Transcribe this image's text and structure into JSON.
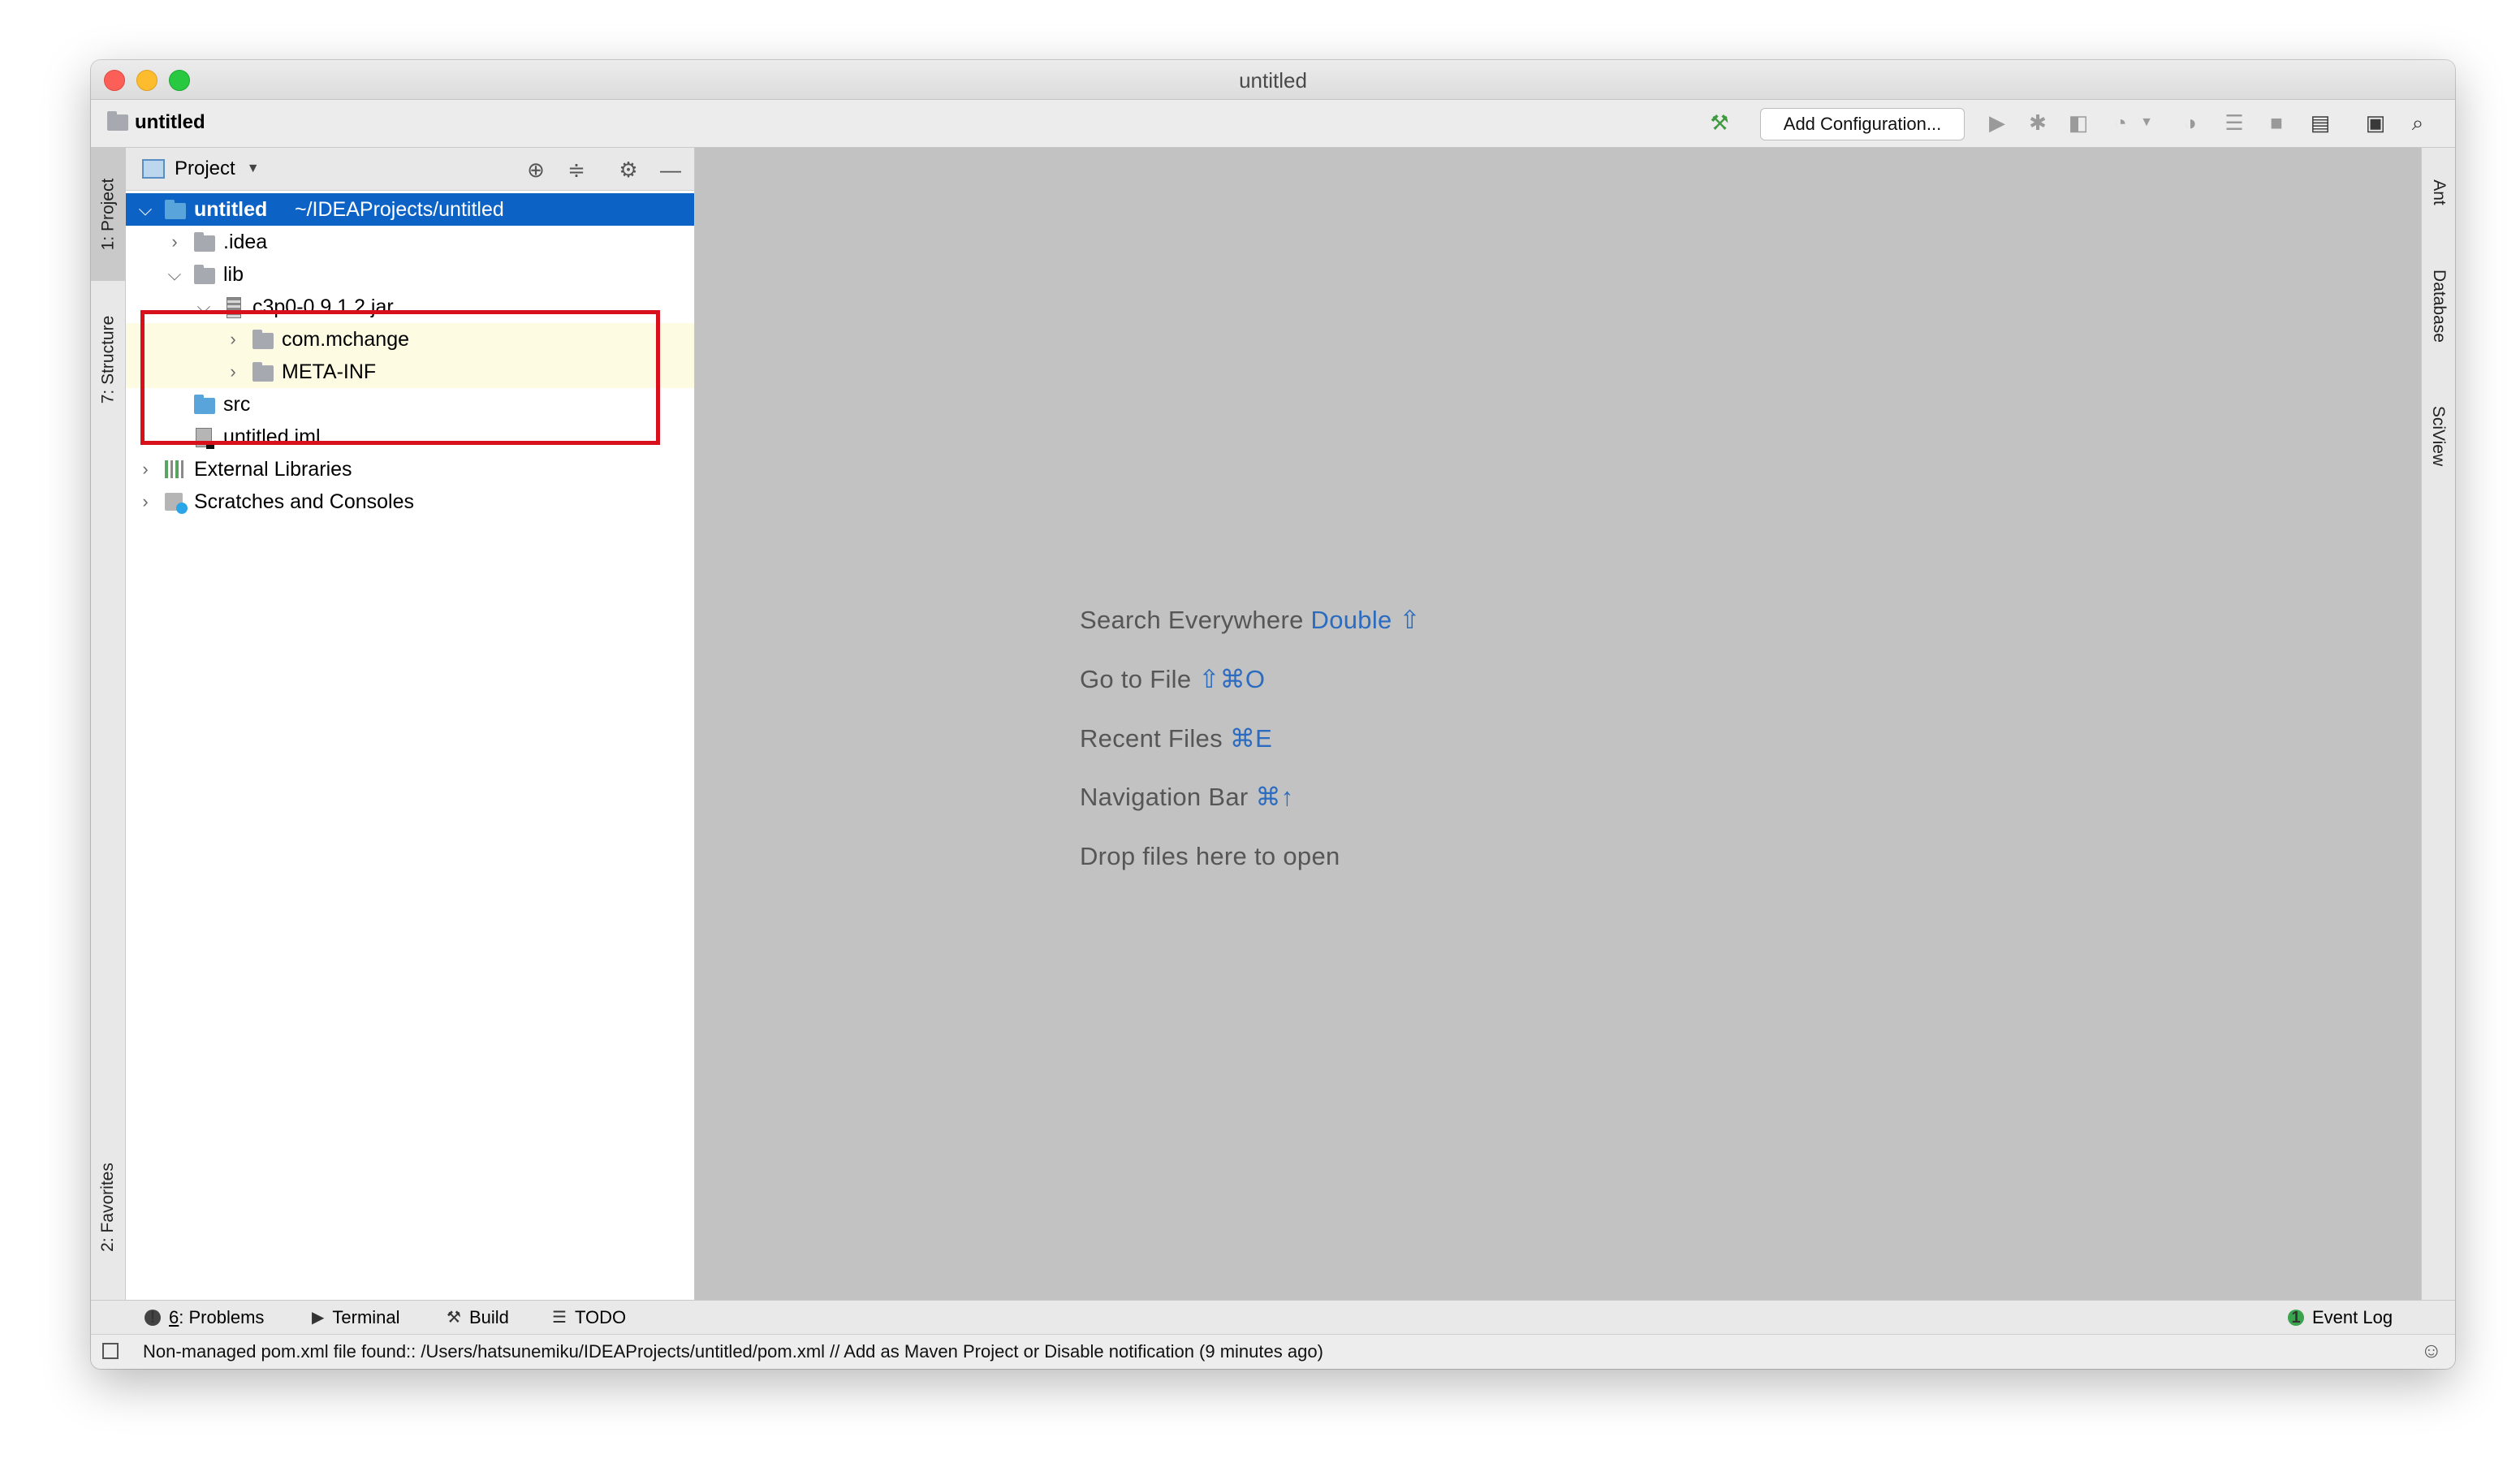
{
  "window": {
    "title": "untitled"
  },
  "navbar": {
    "breadcrumb": "untitled",
    "add_configuration": "Add Configuration..."
  },
  "left_stripe": {
    "tabs": [
      {
        "label": "1: Project"
      },
      {
        "label": "7: Structure"
      },
      {
        "label": "2: Favorites"
      }
    ]
  },
  "project_panel": {
    "title": "Project",
    "tree": [
      {
        "label": "untitled",
        "path": "~/IDEAProjects/untitled"
      },
      {
        "label": ".idea"
      },
      {
        "label": "lib"
      },
      {
        "label": "c3p0-0.9.1.2.jar"
      },
      {
        "label": "com.mchange"
      },
      {
        "label": "META-INF"
      },
      {
        "label": "src"
      },
      {
        "label": "untitled.iml"
      },
      {
        "label": "External Libraries"
      },
      {
        "label": "Scratches and Consoles"
      }
    ]
  },
  "editor_hints": [
    {
      "text": "Search Everywhere",
      "key": "Double ⇧"
    },
    {
      "text": "Go to File",
      "key": "⇧⌘O"
    },
    {
      "text": "Recent Files",
      "key": "⌘E"
    },
    {
      "text": "Navigation Bar",
      "key": "⌘↑"
    },
    {
      "text": "Drop files here to open",
      "key": ""
    }
  ],
  "right_stripe": {
    "tabs": [
      {
        "label": "Ant"
      },
      {
        "label": "Database"
      },
      {
        "label": "SciView"
      }
    ]
  },
  "bottom_tools": {
    "problems_number": "6",
    "problems_label": ": Problems",
    "terminal": "Terminal",
    "build": "Build",
    "todo": "TODO",
    "event_log": "Event Log",
    "event_log_count": "1"
  },
  "status": {
    "message": "Non-managed pom.xml file found:: /Users/hatsunemiku/IDEAProjects/untitled/pom.xml // Add as Maven Project or Disable notification (9 minutes ago)"
  },
  "colors": {
    "selection": "#0d63c5",
    "highlight_box": "#d8101c",
    "editor_bg": "#c2c2c2",
    "shortcut": "#2b6bc0"
  }
}
